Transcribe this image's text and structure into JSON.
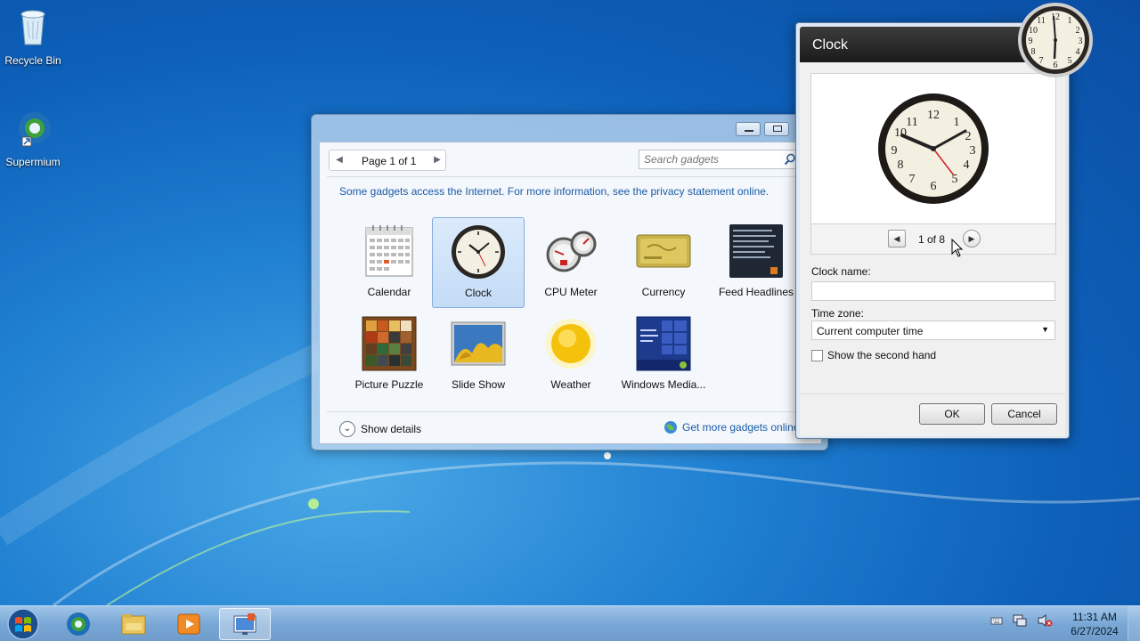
{
  "desktop": {
    "icons": [
      {
        "label": "Recycle Bin",
        "icon": "recycle-bin-icon"
      },
      {
        "label": "Supermium",
        "icon": "supermium-browser-icon"
      }
    ]
  },
  "gallery": {
    "page_label": "Page 1 of 1",
    "search_placeholder": "Search gadgets",
    "notice": "Some gadgets access the Internet.  For more information, see the privacy statement online.",
    "gadgets": [
      {
        "label": "Calendar",
        "icon": "calendar-icon"
      },
      {
        "label": "Clock",
        "icon": "clock-icon",
        "selected": true
      },
      {
        "label": "CPU Meter",
        "icon": "cpu-meter-icon"
      },
      {
        "label": "Currency",
        "icon": "currency-icon"
      },
      {
        "label": "Feed Headlines",
        "icon": "feed-headlines-icon"
      },
      {
        "label": "Picture Puzzle",
        "icon": "picture-puzzle-icon"
      },
      {
        "label": "Slide Show",
        "icon": "slide-show-icon"
      },
      {
        "label": "Weather",
        "icon": "weather-icon"
      },
      {
        "label": "Windows Media...",
        "icon": "windows-media-center-icon"
      }
    ],
    "show_details": "Show details",
    "get_more": "Get more gadgets online"
  },
  "dialog": {
    "title": "Clock",
    "nav_text": "1 of 8",
    "clock_name_label": "Clock name:",
    "clock_name_value": "",
    "time_zone_label": "Time zone:",
    "time_zone_value": "Current computer time",
    "second_hand_label": "Show the second hand",
    "second_hand_checked": false,
    "ok": "OK",
    "cancel": "Cancel"
  },
  "taskbar": {
    "pinned": [
      "supermium-browser-icon",
      "file-explorer-icon",
      "media-player-icon",
      "gadget-control-panel-icon"
    ],
    "time": "11:31 AM",
    "date": "6/27/2024"
  }
}
